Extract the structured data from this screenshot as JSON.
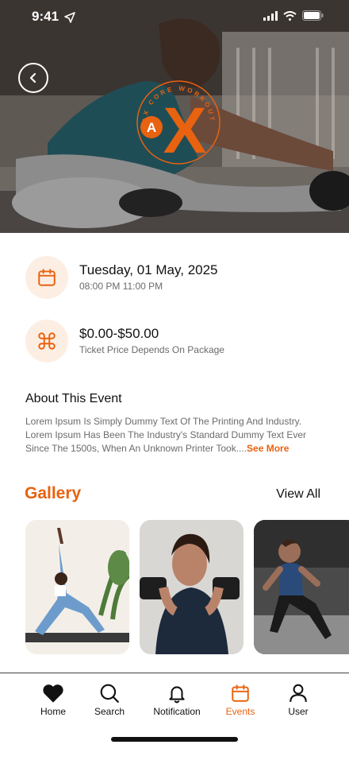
{
  "status_bar": {
    "time": "9:41"
  },
  "hero": {
    "logo_letters": "AX",
    "logo_small_letter": "A",
    "logo_big_letter": "X",
    "logo_ring_text": "AX CORE WORKOUT"
  },
  "event": {
    "date": "Tuesday, 01 May, 2025",
    "time_range": "08:00 PM 11:00 PM",
    "price": "$0.00-$50.00",
    "price_note": "Ticket Price Depends On Package"
  },
  "about": {
    "title": "About This Event",
    "body": "Lorem Ipsum Is Simply Dummy Text Of The Printing And Industry. Lorem Ipsum Has Been The Industry's Standard Dummy Text Ever Since The 1500s, When An Unknown Printer Took....",
    "see_more": "See More"
  },
  "gallery": {
    "title": "Gallery",
    "view_all": "View All"
  },
  "tabs": [
    {
      "label": "Home",
      "icon": "heart-icon"
    },
    {
      "label": "Search",
      "icon": "search-icon"
    },
    {
      "label": "Notification",
      "icon": "bell-icon"
    },
    {
      "label": "Events",
      "icon": "calendar-icon",
      "active": true
    },
    {
      "label": "User",
      "icon": "user-icon"
    }
  ],
  "colors": {
    "accent": "#e8620f",
    "icon_bg": "#fdeee3"
  }
}
